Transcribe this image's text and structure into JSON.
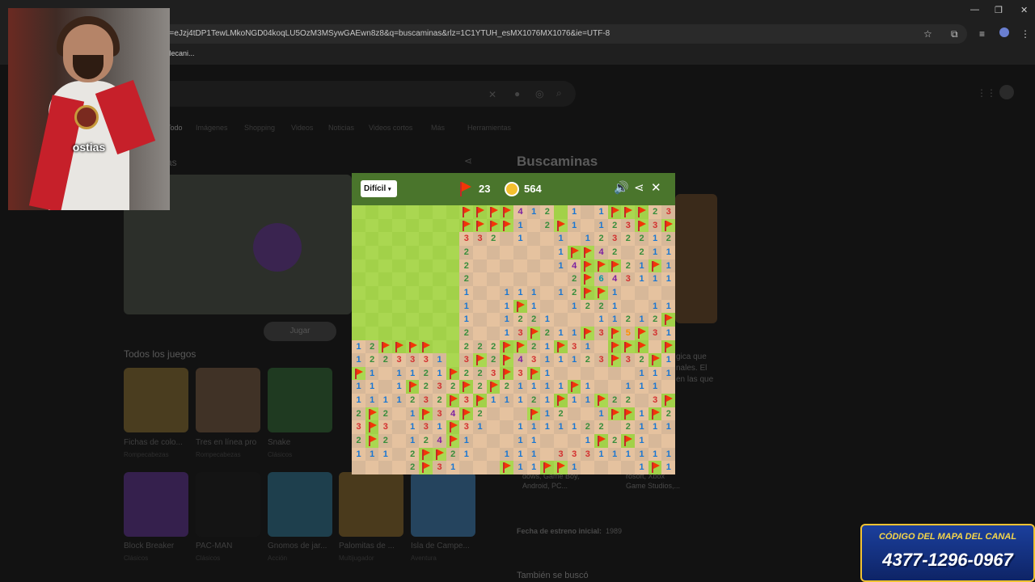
{
  "browser": {
    "url": "p=eJzj4tDP1TewLMkoNGD04koqLU5OzM3MSywGAEwn8z8&q=buscaminas&rlz=1C1YTUH_esMX1076MX1076&ie=UTF-8",
    "bookmark": "Mecani...",
    "window_controls": {
      "minimize": "—",
      "maximize": "❐",
      "close": "✕"
    }
  },
  "search_page": {
    "tabs": [
      "Todo",
      "Imágenes",
      "Shopping",
      "Videos",
      "Noticias",
      "Videos cortos",
      "Más",
      "Herramientas"
    ],
    "left_heading": "mas",
    "play_label": "Jugar",
    "all_games_heading": "Todos los juegos",
    "games_row1": [
      {
        "title": "Fichas de colo...",
        "sub": "Rompecabezas",
        "color": "#e0a82e"
      },
      {
        "title": "Tres en línea pro",
        "sub": "Rompecabezas",
        "color": "#c98a3b"
      },
      {
        "title": "Snake",
        "sub": "Clásicos",
        "color": "#3b8f3f"
      }
    ],
    "games_row2": [
      {
        "title": "Block Breaker",
        "sub": "Clásicos",
        "color": "#7b3fb0"
      },
      {
        "title": "PAC-MAN",
        "sub": "Clásicos",
        "color": "#1b1b1b"
      },
      {
        "title": "Gnomos de jar...",
        "sub": "Acción",
        "color": "#3fa7c9"
      },
      {
        "title": "Palomitas de ...",
        "sub": "Multijugador",
        "color": "#d6a23a"
      },
      {
        "title": "Isla de Campe...",
        "sub": "Aventura",
        "color": "#4fa1e0"
      }
    ],
    "right_title": "Buscaminas",
    "right_snippets": [
      "gica que",
      "nales. El",
      "en las que"
    ],
    "right_platforms": [
      "dows, Game Boy,",
      "Android, PC..."
    ],
    "right_studios": [
      "rosoft, Xbox",
      "Game Studios,..."
    ],
    "release_label": "Fecha de estreno inicial:",
    "release_value": "1989",
    "also_searched": "También se buscó"
  },
  "webcam": {
    "caption": "ostias"
  },
  "game": {
    "difficulty": "Difícil",
    "flags_left": "23",
    "timer": "564",
    "icons": {
      "flag": "flag-icon",
      "timer": "stopwatch-icon",
      "sound": "speaker-icon",
      "share": "share-icon",
      "close": "close-icon"
    },
    "colors": {
      "header": "#4a752c",
      "grass_light": "#aad751",
      "grass_dark": "#a2d149",
      "dirt_light": "#e5c29f",
      "dirt_dark": "#d7b899"
    },
    "rows": [
      "GGGGGGGGFFFF412G1 1FFF23F3123F",
      "GGGGGGGGFFFF1 2F1 123F3F3F2FFF",
      "GGGGGGGG332 1  1 12322121 24F",
      "GGGGGGGG2      1FF42 2111113F",
      "GGGGGGGG2      14FFF21F11F2 2",
      "GGGGGGGG2       2F643111 111",
      "GGGGGGGG1  111 12FF1        ",
      "GGGGGGGG1  1F1  1221  111   ",
      "GGGGGGGG1  1221   11212F1   ",
      "GGGGGGGG2  13F211F3F5F31    ",
      "12FFFFGG222FF21F31 FFF F31F ",
      "1223331G3F2F4311123F32F1    ",
      "F1 1121F223F3F1      11123 1",
      "11 1F232F2F21111F1  111 2FF1",
      "1111232F3F11121F11F22 3F3F3F",
      "2F2 1F34F2   F12  1FF1F2F221",
      "3F3 131F31  1111122 21111 F1",
      "2F2 124F1   11   1F2F1   11",
      "111 2FF21  111 333111111 11",
      "    2F31   F11FF1    1F1   "
    ]
  }
}
